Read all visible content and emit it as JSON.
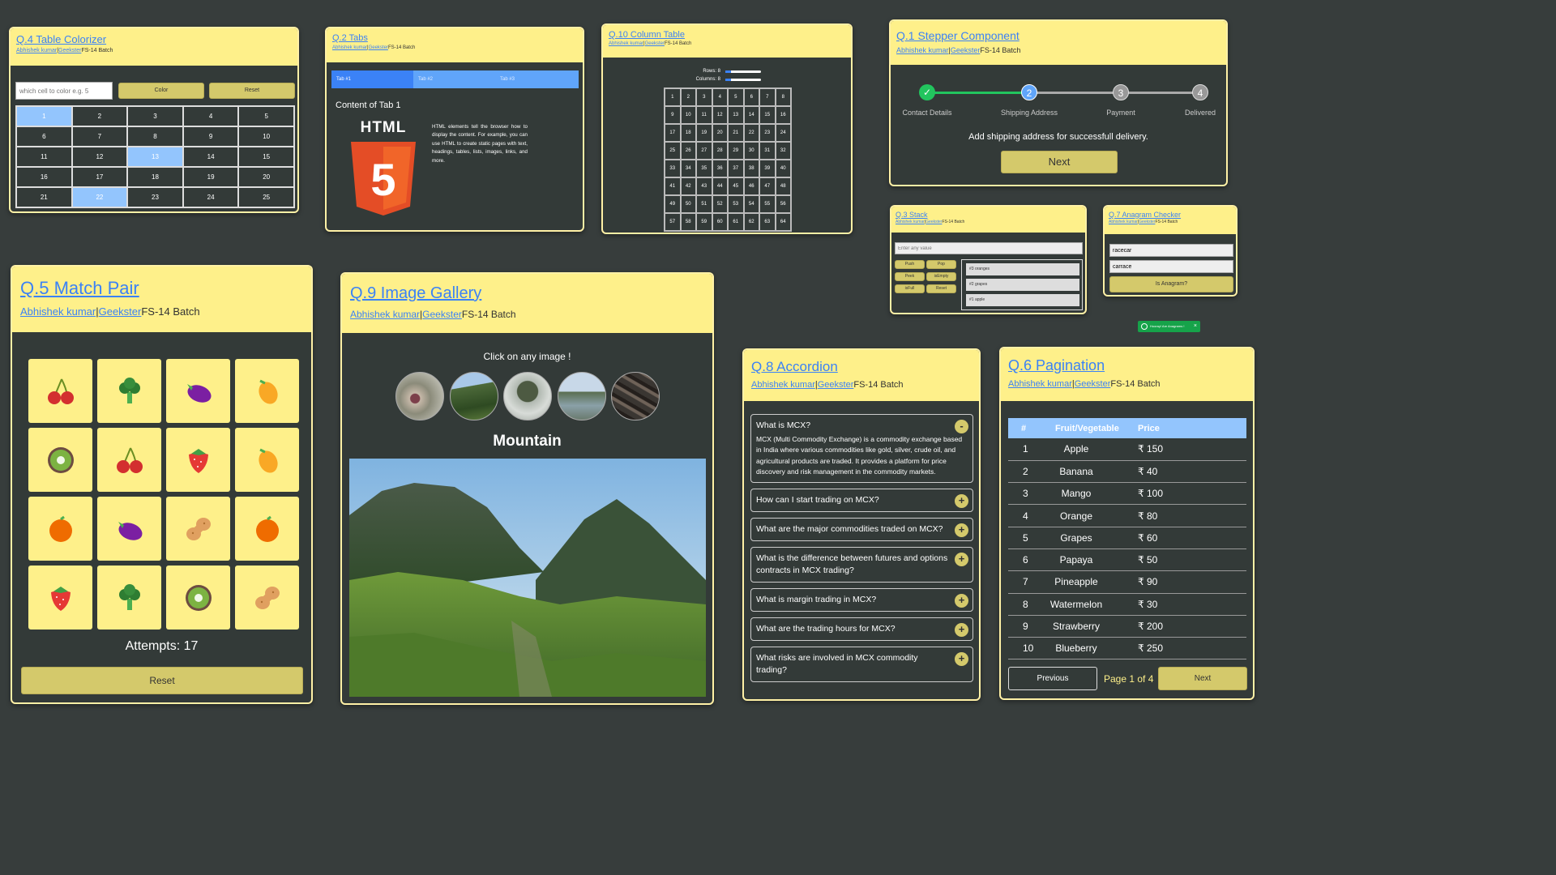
{
  "author": "Abhishek kumar",
  "org": "Geekster",
  "batch": "FS-14 Batch",
  "tc": {
    "title": "Q.4 Table Colorizer",
    "placeholder": "which cell to color e.g. 5",
    "color_btn": "Color",
    "reset_btn": "Reset",
    "cells": [
      "1",
      "2",
      "3",
      "4",
      "5",
      "6",
      "7",
      "8",
      "9",
      "10",
      "11",
      "12",
      "13",
      "14",
      "15",
      "16",
      "17",
      "18",
      "19",
      "20",
      "21",
      "22",
      "23",
      "24",
      "25"
    ],
    "colored": [
      1,
      13,
      22
    ],
    "highlight_color": "#93c5fd"
  },
  "tabs": {
    "title": "Q.2 Tabs",
    "items": [
      "Tab #1",
      "Tab #2",
      "Tab #3"
    ],
    "content_title": "Content of Tab 1",
    "logo_text": "HTML",
    "logo_digit": "5",
    "body": "HTML elements tell the browser how to display the content. For example, you can use HTML to create static pages with text, headings, tables, lists, images, links, and more.",
    "active_color": "#3b82f6",
    "tab_color": "#60a5fa"
  },
  "ct": {
    "title": "Q.10 Column Table",
    "rows_label": "Rows: 8",
    "cols_label": "Columns: 8",
    "rows_value": 8,
    "cols_value": 8
  },
  "stepper": {
    "title": "Q.1 Stepper Component",
    "steps": [
      {
        "num": "✓",
        "label": "Contact Details"
      },
      {
        "num": "2",
        "label": "Shipping Address"
      },
      {
        "num": "3",
        "label": "Payment"
      },
      {
        "num": "4",
        "label": "Delivered"
      }
    ],
    "message": "Add shipping address for successfull delivery.",
    "next_btn": "Next",
    "done_color": "#22c55e",
    "active_color": "#60a5fa"
  },
  "stack": {
    "title": "Q.3 Stack",
    "placeholder": "Enter any value",
    "buttons": [
      "Push",
      "Pop",
      "Peek",
      "isEmpty",
      "isFull",
      "Reset"
    ],
    "items": [
      "#3 oranges",
      "#2 grapes",
      "#1 apple"
    ]
  },
  "anagram": {
    "title": "Q.7 Anagram Checker",
    "word1": "racecar",
    "word2": "carrace",
    "button": "Is Anagram?",
    "toast": "Hooray! Are Anagrams !",
    "toast_close": "×"
  },
  "mp": {
    "title": "Q.5 Match Pair",
    "cards": [
      "cherry",
      "broccoli",
      "eggplant",
      "mango",
      "kiwi",
      "cherry",
      "strawberry",
      "mango",
      "orange",
      "eggplant",
      "peanut",
      "orange",
      "strawberry",
      "broccoli",
      "kiwi",
      "peanut"
    ],
    "attempts": "Attempts: 17",
    "reset": "Reset"
  },
  "gallery": {
    "title": "Q.9 Image Gallery",
    "prompt": "Click on any image !",
    "thumbnails": [
      "fruit",
      "mountain",
      "tree",
      "lake",
      "wood"
    ],
    "selected": "Mountain"
  },
  "accordion": {
    "title": "Q.8 Accordion",
    "items": [
      {
        "q": "What is MCX?",
        "a": "MCX (Multi Commodity Exchange) is a commodity exchange based in India where various commodities like gold, silver, crude oil, and agricultural products are traded. It provides a platform for price discovery and risk management in the commodity markets.",
        "open": true,
        "sym": "-"
      },
      {
        "q": "How can I start trading on MCX?",
        "sym": "+"
      },
      {
        "q": "What are the major commodities traded on MCX?",
        "sym": "+"
      },
      {
        "q": "What is the difference between futures and options contracts in MCX trading?",
        "sym": "+"
      },
      {
        "q": "What is margin trading in MCX?",
        "sym": "+"
      },
      {
        "q": "What are the trading hours for MCX?",
        "sym": "+"
      },
      {
        "q": "What risks are involved in MCX commodity trading?",
        "sym": "+"
      }
    ]
  },
  "pagination": {
    "title": "Q.6 Pagination",
    "headers": [
      "#",
      "Fruit/Vegetable",
      "Price"
    ],
    "rows": [
      [
        "1",
        "Apple",
        "₹ 150"
      ],
      [
        "2",
        "Banana",
        "₹ 40"
      ],
      [
        "3",
        "Mango",
        "₹ 100"
      ],
      [
        "4",
        "Orange",
        "₹ 80"
      ],
      [
        "5",
        "Grapes",
        "₹ 60"
      ],
      [
        "6",
        "Papaya",
        "₹ 50"
      ],
      [
        "7",
        "Pineapple",
        "₹ 90"
      ],
      [
        "8",
        "Watermelon",
        "₹ 30"
      ],
      [
        "9",
        "Strawberry",
        "₹ 200"
      ],
      [
        "10",
        "Blueberry",
        "₹ 250"
      ]
    ],
    "prev": "Previous",
    "page_info": "Page 1 of 4",
    "next": "Next"
  }
}
